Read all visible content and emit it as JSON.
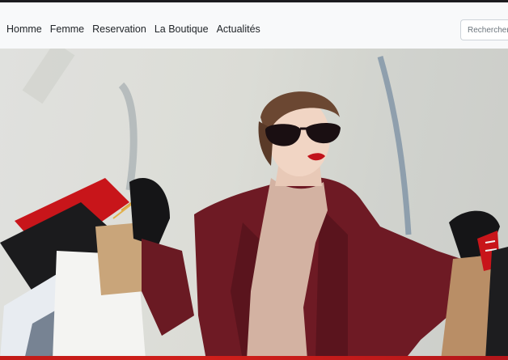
{
  "nav": {
    "links": [
      "Homme",
      "Femme",
      "Reservation",
      "La Boutique",
      "Actualités"
    ]
  },
  "search": {
    "placeholder": "Rechercher"
  },
  "hero": {
    "image": "woman-with-shopping-bags",
    "colors": {
      "coat": "#6e1a24",
      "accent_red": "#c21b18",
      "background": "#d9dad4"
    }
  }
}
